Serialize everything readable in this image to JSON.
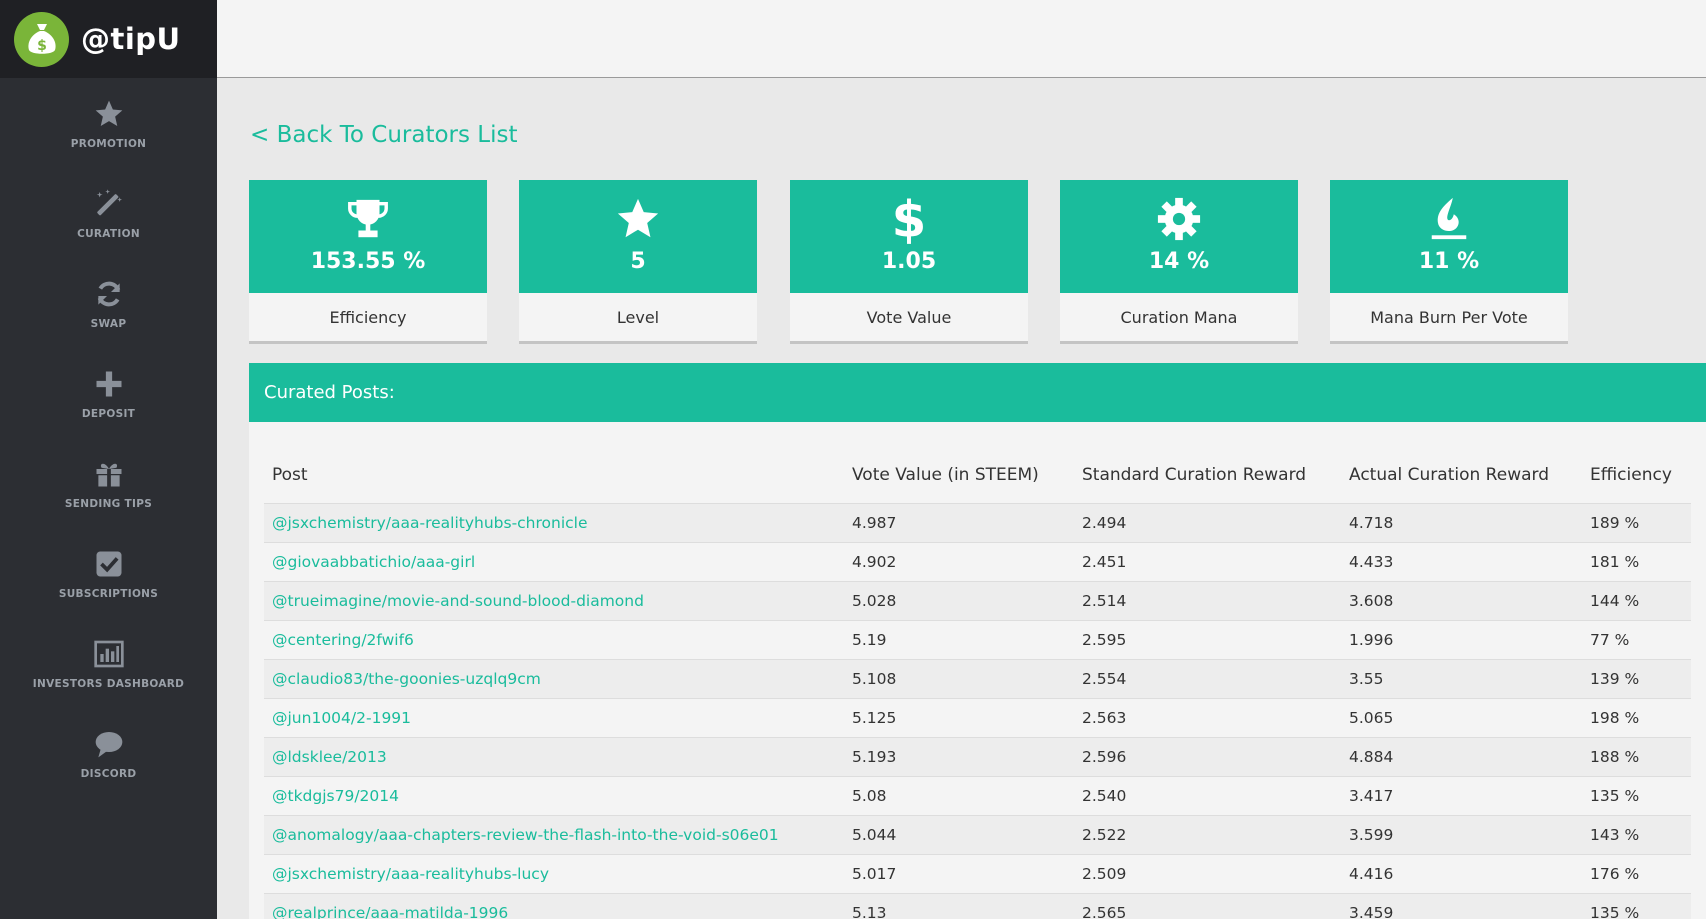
{
  "brand": {
    "name": "@tipU"
  },
  "sidebar": {
    "items": [
      {
        "label": "PROMOTION",
        "icon": "star-icon"
      },
      {
        "label": "CURATION",
        "icon": "magic-wand-icon"
      },
      {
        "label": "SWAP",
        "icon": "refresh-icon"
      },
      {
        "label": "DEPOSIT",
        "icon": "plus-icon"
      },
      {
        "label": "SENDING TIPS",
        "icon": "gift-icon"
      },
      {
        "label": "SUBSCRIPTIONS",
        "icon": "checkbox-icon"
      },
      {
        "label": "INVESTORS DASHBOARD",
        "icon": "bar-chart-icon"
      },
      {
        "label": "DISCORD",
        "icon": "chat-bubble-icon"
      }
    ]
  },
  "main": {
    "back_link": "< Back To Curators List",
    "stats": [
      {
        "value": "153.55 %",
        "label": "Efficiency",
        "icon": "trophy-icon"
      },
      {
        "value": "5",
        "label": "Level",
        "icon": "star-icon"
      },
      {
        "value": "1.05",
        "label": "Vote Value",
        "icon": "dollar-icon"
      },
      {
        "value": "14 %",
        "label": "Curation Mana",
        "icon": "gear-icon"
      },
      {
        "value": "11 %",
        "label": "Mana Burn Per Vote",
        "icon": "flame-icon"
      }
    ],
    "panel_title": "Curated Posts:",
    "table": {
      "headers": [
        "Post",
        "Vote Value (in STEEM)",
        "Standard Curation Reward",
        "Actual Curation Reward",
        "Efficiency"
      ],
      "rows": [
        [
          "@jsxchemistry/aaa-realityhubs-chronicle",
          "4.987",
          "2.494",
          "4.718",
          "189 %"
        ],
        [
          "@giovaabbatichio/aaa-girl",
          "4.902",
          "2.451",
          "4.433",
          "181 %"
        ],
        [
          "@trueimagine/movie-and-sound-blood-diamond",
          "5.028",
          "2.514",
          "3.608",
          "144 %"
        ],
        [
          "@centering/2fwif6",
          "5.19",
          "2.595",
          "1.996",
          "77 %"
        ],
        [
          "@claudio83/the-goonies-uzqlq9cm",
          "5.108",
          "2.554",
          "3.55",
          "139 %"
        ],
        [
          "@jun1004/2-1991",
          "5.125",
          "2.563",
          "5.065",
          "198 %"
        ],
        [
          "@ldsklee/2013",
          "5.193",
          "2.596",
          "4.884",
          "188 %"
        ],
        [
          "@tkdgjs79/2014",
          "5.08",
          "2.540",
          "3.417",
          "135 %"
        ],
        [
          "@anomalogy/aaa-chapters-review-the-flash-into-the-void-s06e01",
          "5.044",
          "2.522",
          "3.599",
          "143 %"
        ],
        [
          "@jsxchemistry/aaa-realityhubs-lucy",
          "5.017",
          "2.509",
          "4.416",
          "176 %"
        ],
        [
          "@realprince/aaa-matilda-1996",
          "5.13",
          "2.565",
          "3.459",
          "135 %"
        ]
      ]
    }
  },
  "colors": {
    "accent": "#1abc9c",
    "sidebar": "#2c2e33",
    "brand_logo": "#7ab539"
  }
}
